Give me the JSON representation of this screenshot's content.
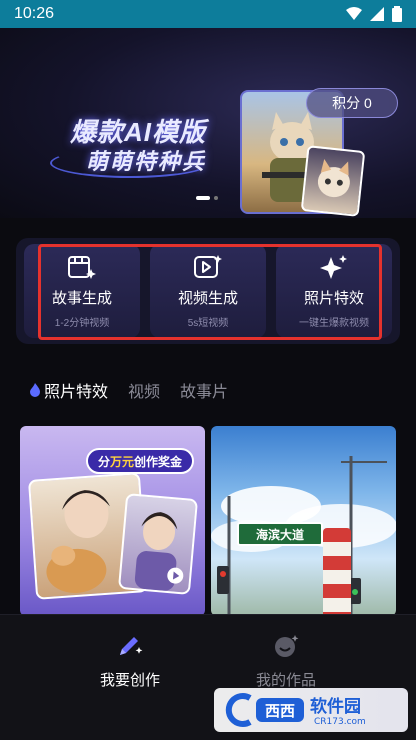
{
  "status_bar": {
    "time": "10:26"
  },
  "banner": {
    "title_line1": "爆款AI模版",
    "title_line2": "萌萌特种兵",
    "points_label": "积分 0"
  },
  "features": [
    {
      "label": "故事生成",
      "sub": "1-2分钟视频",
      "icon": "film-sparkle-icon"
    },
    {
      "label": "视频生成",
      "sub": "5s短视频",
      "icon": "video-sparkle-icon"
    },
    {
      "label": "照片特效",
      "sub": "一键生爆款视频",
      "icon": "sparkles-icon"
    }
  ],
  "tabs": [
    {
      "label": "照片特效",
      "active": true
    },
    {
      "label": "视频",
      "active": false
    },
    {
      "label": "故事片",
      "active": false
    }
  ],
  "cards": {
    "left_badge_pre": "分",
    "left_badge_highlight": "万元",
    "left_badge_post": "创作奖金",
    "right_sign": "海滨大道"
  },
  "bottom_nav": [
    {
      "label": "我要创作",
      "icon": "pencil-sparkle-icon",
      "active": true
    },
    {
      "label": "我的作品",
      "icon": "smile-sparkle-icon",
      "active": false
    }
  ],
  "watermark": {
    "text": "CR173.com",
    "brand": "西西软件园"
  },
  "colors": {
    "status_bar": "#0d7d9b",
    "highlight": "#e5322d",
    "accent": "#5b6bff"
  }
}
